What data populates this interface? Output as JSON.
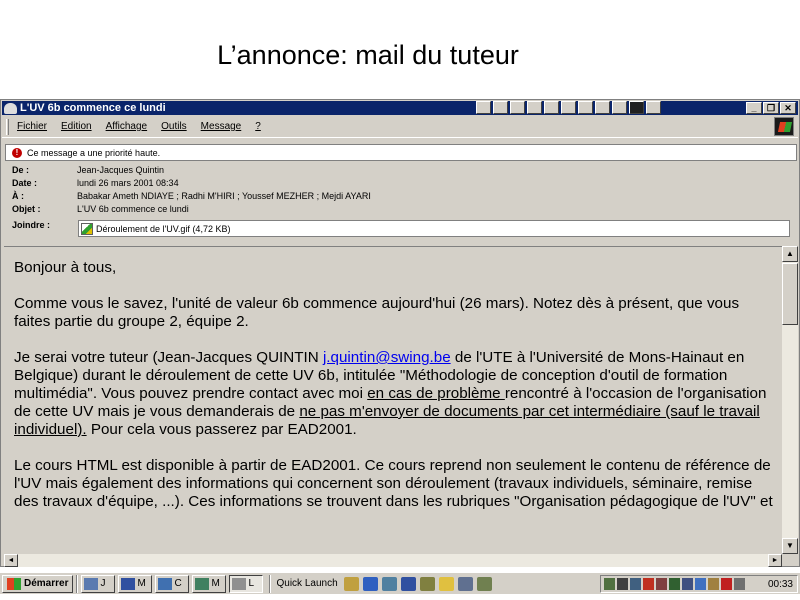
{
  "slide": {
    "title": "L’annonce: mail du tuteur"
  },
  "window": {
    "title": "L'UV 6b commence ce lundi",
    "controls": {
      "minimize": "_",
      "restore": "❐",
      "close": "✕"
    }
  },
  "menu": {
    "items": [
      "Fichier",
      "Edition",
      "Affichage",
      "Outils",
      "Message",
      "?"
    ]
  },
  "message": {
    "priority_notice": "Ce message a une priorité haute.",
    "headers": {
      "from_label": "De :",
      "from": "Jean-Jacques Quintin",
      "date_label": "Date :",
      "date": "lundi 26 mars 2001 08:34",
      "to_label": "À :",
      "to": "Babakar Ameth NDIAYE ; Radhi M'HIRI ; Youssef MEZHER ; Mejdi AYARI",
      "subject_label": "Objet :",
      "subject": "L'UV 6b commence ce lundi",
      "attach_label": "Joindre :",
      "attachment": "Déroulement de l'UV.gif (4,72 KB)"
    },
    "body": {
      "greeting": "Bonjour à tous,",
      "p1": "Comme vous le savez, l'unité de valeur 6b commence aujourd'hui (26 mars). Notez dès à présent, que vous faites partie du groupe 2, équipe 2.",
      "p2_a": "Je serai votre tuteur (Jean-Jacques QUINTIN ",
      "p2_email": "j.quintin@swing.be",
      "p2_b": " de l'UTE à l'Université de Mons-Hainaut en Belgique) durant le déroulement de cette UV 6b, intitulée \"Méthodologie de conception d'outil de formation multimédia\". Vous pouvez prendre contact avec moi ",
      "p2_u1": "en cas de problème ",
      "p2_c": "rencontré à l'occasion de l'organisation de cette UV mais je vous demanderais de ",
      "p2_u2": "ne pas m'envoyer de documents par cet intermédiaire (sauf le travail individuel).",
      "p2_d": " Pour cela vous passerez par EAD2001.",
      "p3": "Le cours HTML est disponible à partir de EAD2001. Ce cours reprend non seulement le contenu de référence de l'UV mais également des informations qui concernent son déroulement (travaux individuels, séminaire, remise des travaux d'équipe, ...). Ces informations se trouvent dans les rubriques \"Organisation pédagogique de l'UV\" et"
    }
  },
  "taskbar": {
    "start_label": "Démarrer",
    "tasks": [
      "J",
      "M",
      "C",
      "M",
      "L"
    ],
    "quick_launch_label": "Quick Launch",
    "clock": "00:33"
  },
  "scroll": {
    "up": "▲",
    "down": "▼",
    "left": "◄",
    "right": "►"
  }
}
